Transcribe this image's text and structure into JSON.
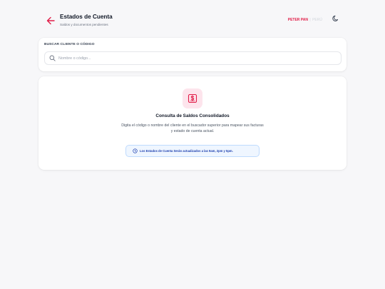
{
  "header": {
    "title": "Estados de Cuenta",
    "subtitle": "Saldos y documentos pendientes",
    "brand_primary": "PETER PAN",
    "brand_separator": "|",
    "brand_secondary": "PERÚ",
    "icons": {
      "back": "arrow-left-icon",
      "theme": "moon-icon"
    }
  },
  "search": {
    "label": "BUSCAR CLIENTE O CÓDIGO",
    "placeholder": "Nombre o código...",
    "value": "",
    "icon": "search-icon"
  },
  "info": {
    "icon": "dollar-document-icon",
    "title": "Consulta de Saldos Consolidados",
    "description": "Digita el código o nombre del cliente en el buscador superior para mapear sus facturas y estado de cuenta actual.",
    "notice": "Los Estados de Cuenta Serán actualizados a las 9am, 2pm y 5pm.",
    "notice_icon": "clock-icon"
  },
  "colors": {
    "accent": "#e11d48",
    "icon_bg": "#fde4ec",
    "notice_bg": "#eff6ff",
    "notice_text": "#1e40af",
    "page_bg": "#f7f7f9"
  }
}
